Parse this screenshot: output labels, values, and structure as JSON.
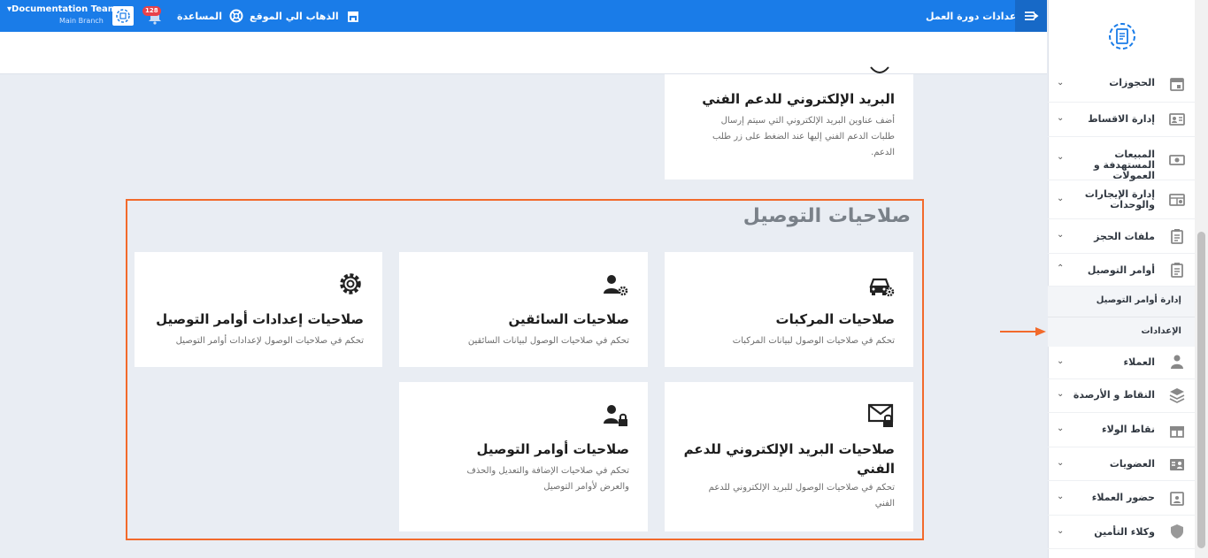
{
  "topbar": {
    "user_name": "Documentation Team",
    "branch": "Main Branch",
    "notification_count": "128",
    "help_label": "المساعدة",
    "goto_site_label": "الذهاب الي الموقع",
    "page_title": "اعدادات دورة العمل"
  },
  "content": {
    "top_card": {
      "title": "البريد الإلكتروني للدعم الفني",
      "desc": "أضف عناوين البريد الإلكتروني التي سيتم إرسال طلبات الدعم الفني إليها عند الضغط على زر طلب الدعم."
    },
    "section_title": "صلاحيات التوصيل",
    "cards": [
      {
        "title": "صلاحيات المركبات",
        "desc": "تحكم في صلاحيات الوصول لبيانات المركبات",
        "icon": "car-settings-icon"
      },
      {
        "title": "صلاحيات السائقين",
        "desc": "تحكم في صلاحيات الوصول لبيانات السائقين",
        "icon": "user-settings-icon"
      },
      {
        "title": "صلاحيات إعدادات أوامر التوصيل",
        "desc": "تحكم في صلاحيات الوصول لإعدادات أوامر التوصيل",
        "icon": "gear-icon"
      },
      {
        "title": "صلاحيات البريد الإلكتروني للدعم الفني",
        "desc": "تحكم في صلاحيات الوصول للبريد الإلكتروني للدعم الفني",
        "icon": "mail-lock-icon"
      },
      {
        "title": "صلاحيات أوامر التوصيل",
        "desc": "تحكم في صلاحيات الإضافة والتعديل والحذف والعرض لأوامر التوصيل",
        "icon": "user-lock-icon"
      }
    ]
  },
  "sidebar": {
    "items": [
      {
        "label": "الحجوزات",
        "icon": "calendar-icon"
      },
      {
        "label": "إدارة الاقساط",
        "icon": "id-card-icon"
      },
      {
        "label": "المبيعات المستهدفة و العمولات",
        "icon": "money-icon"
      },
      {
        "label": "إدارة الإيجارات والوحدات",
        "icon": "building-icon"
      },
      {
        "label": "ملفات الحجز",
        "icon": "clipboard-icon"
      },
      {
        "label": "أوامر التوصيل",
        "icon": "clipboard-icon"
      },
      {
        "label": "العملاء",
        "icon": "user-icon"
      },
      {
        "label": "النقاط و الأرصدة",
        "icon": "layers-icon"
      },
      {
        "label": "نقاط الولاء",
        "icon": "gift-icon"
      },
      {
        "label": "العضويات",
        "icon": "membership-card-icon"
      },
      {
        "label": "حضور العملاء",
        "icon": "calendar-user-icon"
      },
      {
        "label": "وكلاء التأمين",
        "icon": "shield-icon"
      }
    ],
    "sub_items": [
      {
        "label": "إدارة أوامر التوصيل"
      },
      {
        "label": "الإعدادات"
      }
    ]
  },
  "colors": {
    "primary": "#1a7ce8",
    "highlight": "#f26a2b",
    "background": "#e9edf3"
  }
}
